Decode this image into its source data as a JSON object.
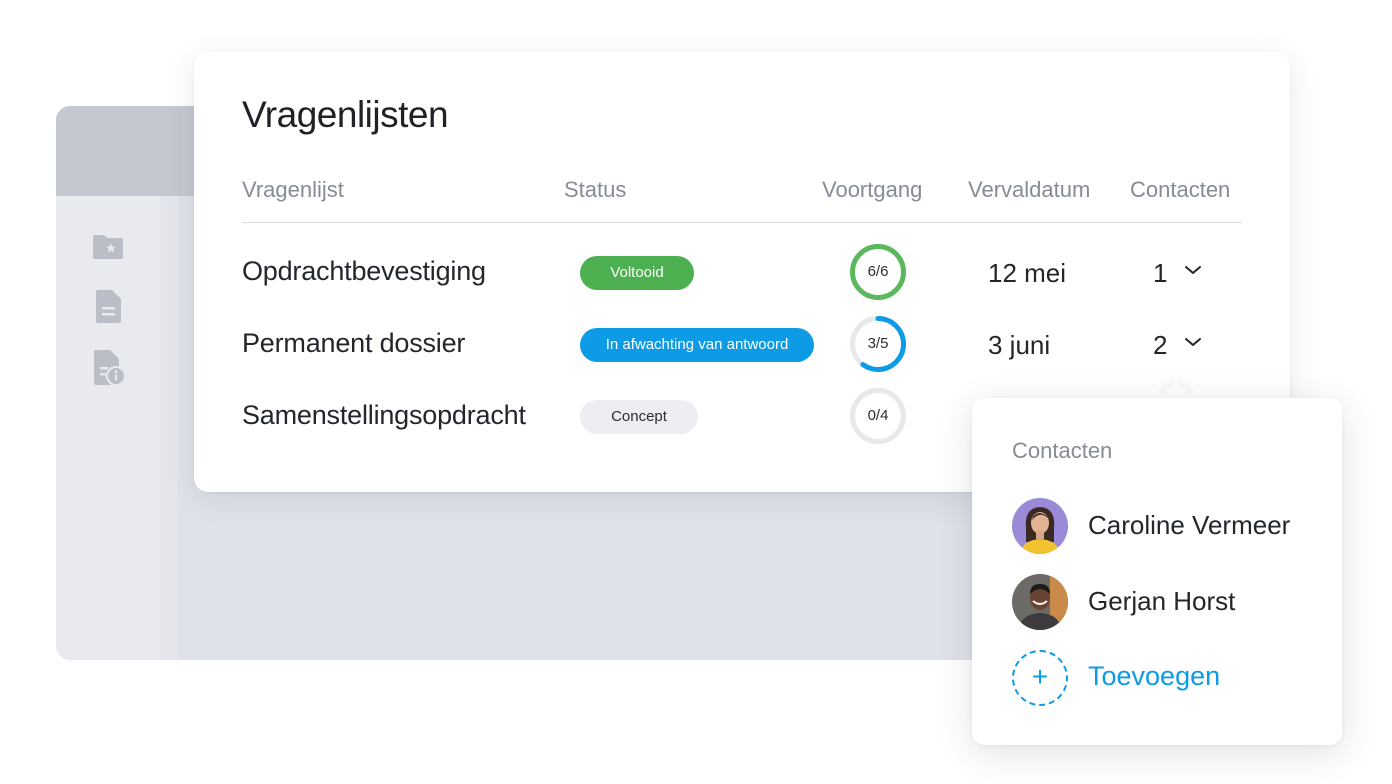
{
  "page": {
    "title": "Vragenlijsten",
    "columns": [
      "Vragenlijst",
      "Status",
      "Voortgang",
      "Vervaldatum",
      "Contacten"
    ]
  },
  "rows": [
    {
      "name": "Opdrachtbevestiging",
      "status": "Voltooid",
      "status_color": "#4caf50",
      "progress_label": "6/6",
      "progress": 1.0,
      "progress_color": "#5cb85c",
      "due": "12 mei",
      "contacts": "1"
    },
    {
      "name": "Permanent dossier",
      "status": "In afwachting van antwoord",
      "status_color": "#0e9be6",
      "progress_label": "3/5",
      "progress": 0.6,
      "progress_color": "#0e9be6",
      "due": "3 juni",
      "contacts": "2"
    },
    {
      "name": "Samenstellingsopdracht",
      "status": "Concept",
      "status_color": "#eceef1",
      "progress_label": "0/4",
      "progress": 0.0,
      "progress_color": "#e6e8eb",
      "due": "",
      "contacts": ""
    }
  ],
  "popover": {
    "title": "Contacten",
    "contacts": [
      {
        "name": "Caroline Vermeer",
        "avatar": "woman-avatar"
      },
      {
        "name": "Gerjan Horst",
        "avatar": "man-avatar"
      }
    ],
    "add_label": "Toevoegen",
    "add_icon": "+"
  },
  "sidebar_icons": [
    "folder-star-icon",
    "document-icon",
    "document-info-icon"
  ],
  "colors": {
    "accent": "#0e9be6",
    "success": "#4caf50"
  }
}
